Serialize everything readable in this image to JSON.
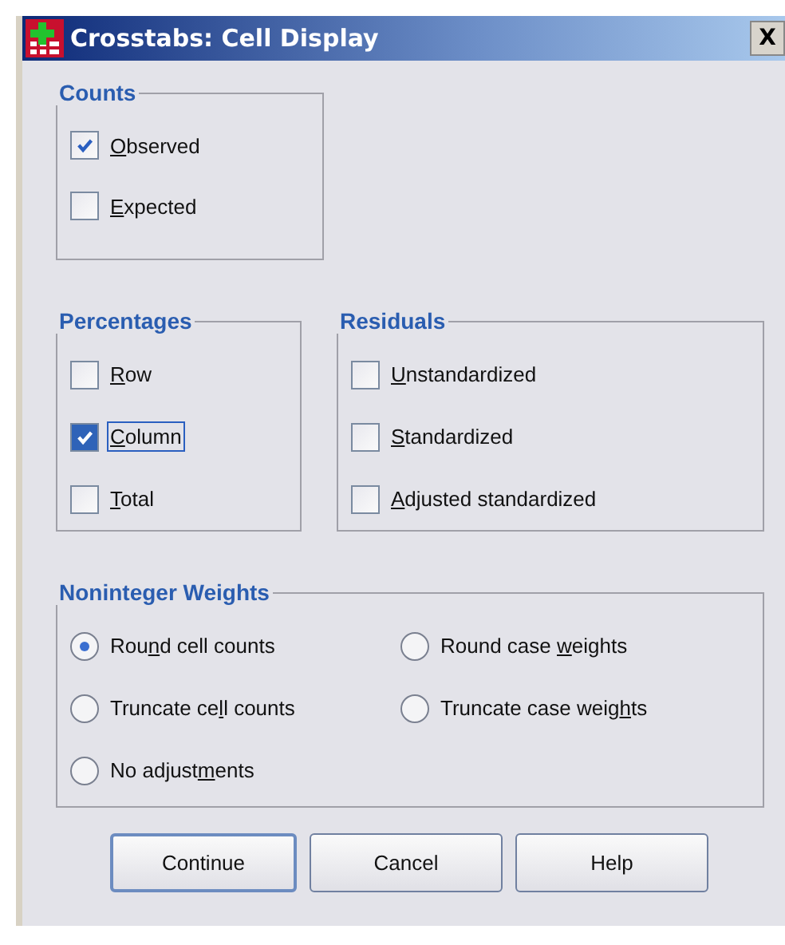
{
  "window": {
    "title": "Crosstabs: Cell Display",
    "close": "X"
  },
  "counts": {
    "title": "Counts",
    "items": [
      {
        "label": {
          "key": "O",
          "after": "bserved"
        },
        "checked": true,
        "focused": false
      },
      {
        "label": {
          "key": "E",
          "after": "xpected"
        },
        "checked": false,
        "focused": false
      }
    ]
  },
  "percentages": {
    "title": "Percentages",
    "items": [
      {
        "label": {
          "key": "R",
          "after": "ow"
        },
        "checked": false,
        "focused": false
      },
      {
        "label": {
          "key": "C",
          "after": "olumn"
        },
        "checked": true,
        "focused": true
      },
      {
        "label": {
          "key": "T",
          "after": "otal"
        },
        "checked": false,
        "focused": false
      }
    ]
  },
  "residuals": {
    "title": "Residuals",
    "items": [
      {
        "label": {
          "key": "U",
          "after": "nstandardized"
        },
        "checked": false,
        "focused": false
      },
      {
        "label": {
          "key": "S",
          "after": "tandardized"
        },
        "checked": false,
        "focused": false
      },
      {
        "label": {
          "key": "A",
          "after": "djusted standardized"
        },
        "checked": false,
        "focused": false
      }
    ]
  },
  "noninteger_weights": {
    "title": "Noninteger Weights",
    "options": [
      {
        "label": {
          "before": "Rou",
          "key": "n",
          "after": "d cell counts"
        },
        "selected": true
      },
      {
        "label": {
          "before": "Round case ",
          "key": "w",
          "after": "eights"
        },
        "selected": false
      },
      {
        "label": {
          "before": "Truncate ce",
          "key": "l",
          "after": "l counts"
        },
        "selected": false
      },
      {
        "label": {
          "before": "Truncate case weig",
          "key": "h",
          "after": "ts"
        },
        "selected": false
      },
      {
        "label": {
          "before": "No adjust",
          "key": "m",
          "after": "ents"
        },
        "selected": false
      }
    ]
  },
  "buttons": [
    {
      "label": "Continue",
      "default": true
    },
    {
      "label": "Cancel",
      "default": false
    },
    {
      "label": "Help",
      "default": false
    }
  ]
}
